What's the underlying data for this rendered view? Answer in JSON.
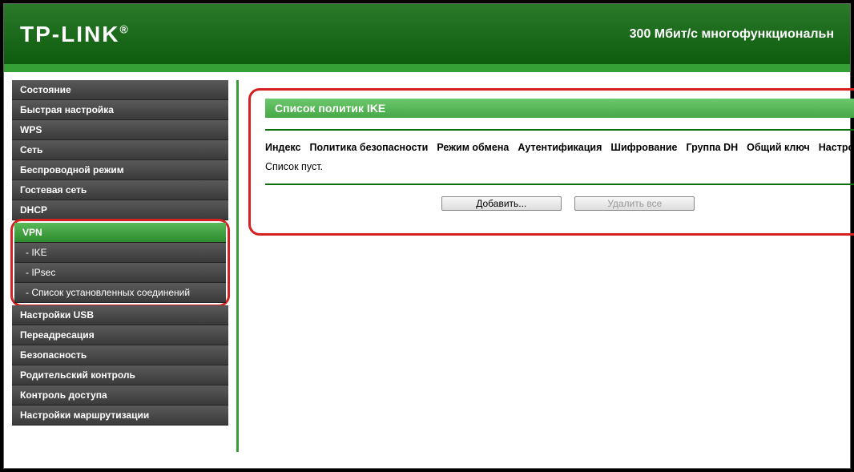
{
  "header": {
    "logo_main": "TP-LINK",
    "logo_reg": "®",
    "subtitle": "300 Мбит/с многофункциональн"
  },
  "sidebar": {
    "items_top": [
      "Состояние",
      "Быстрая настройка",
      "WPS",
      "Сеть",
      "Беспроводной режим",
      "Гостевая сеть",
      "DHCP"
    ],
    "vpn_parent": "VPN",
    "vpn_children": [
      "- IKE",
      "- IPsec",
      "- Список установленных соединений"
    ],
    "items_bottom": [
      "Настройки USB",
      "Переадресация",
      "Безопасность",
      "Родительский контроль",
      "Контроль доступа",
      "Настройки маршрутизации"
    ]
  },
  "content": {
    "title": "Список политик IKE",
    "columns": [
      "Индекс",
      "Политика безопасности",
      "Режим обмена",
      "Аутентификация",
      "Шифрование",
      "Группа DH",
      "Общий ключ",
      "Настройка"
    ],
    "empty": "Список пуст.",
    "btn_add": "Добавить...",
    "btn_delete_all": "Удалить все"
  }
}
